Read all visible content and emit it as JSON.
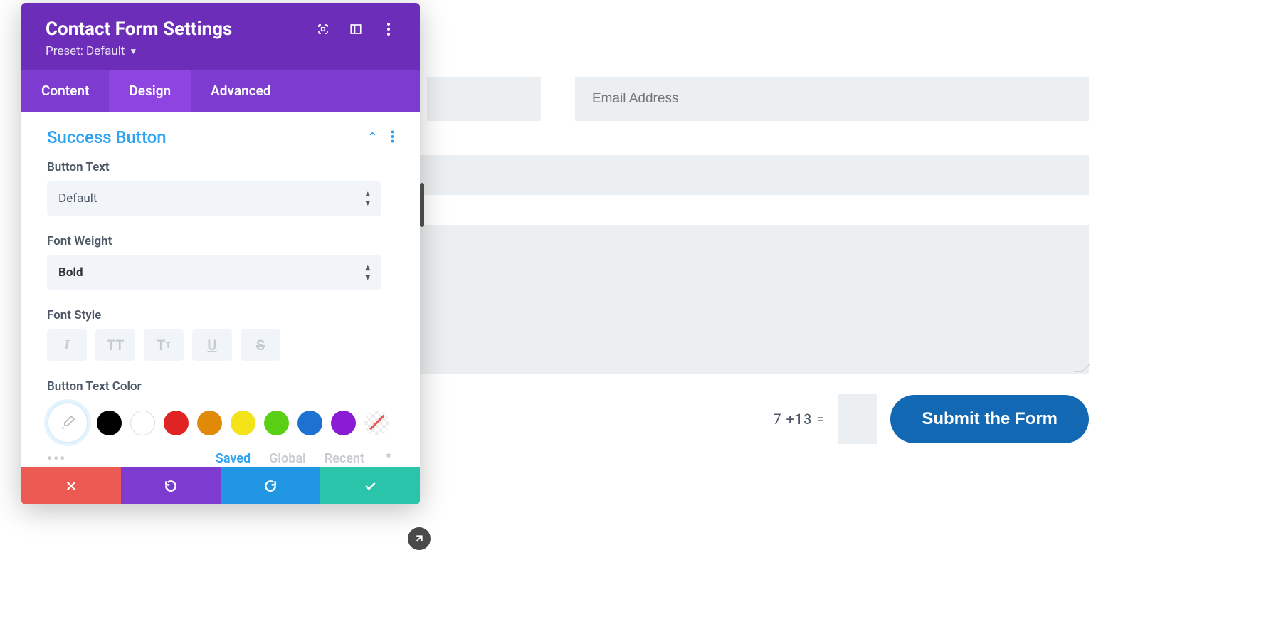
{
  "panel": {
    "title": "Contact Form Settings",
    "preset_label": "Preset: Default",
    "tabs": {
      "content": "Content",
      "design": "Design",
      "advanced": "Advanced"
    },
    "section_title": "Success Button",
    "button_text_label": "Button Text",
    "button_text_value": "Default",
    "font_weight_label": "Font Weight",
    "font_weight_value": "Bold",
    "font_style_label": "Font Style",
    "button_text_color_label": "Button Text Color",
    "color_tabs": {
      "saved": "Saved",
      "global": "Global",
      "recent": "Recent"
    },
    "swatches": [
      "#000000",
      "#ffffff",
      "#e02424",
      "#e08a08",
      "#f3e318",
      "#5ad015",
      "#1d72d1",
      "#8a1dd3"
    ]
  },
  "preview": {
    "email_placeholder": "Email Address",
    "captcha": "7 +13 =",
    "submit_label": "Submit the Form"
  }
}
